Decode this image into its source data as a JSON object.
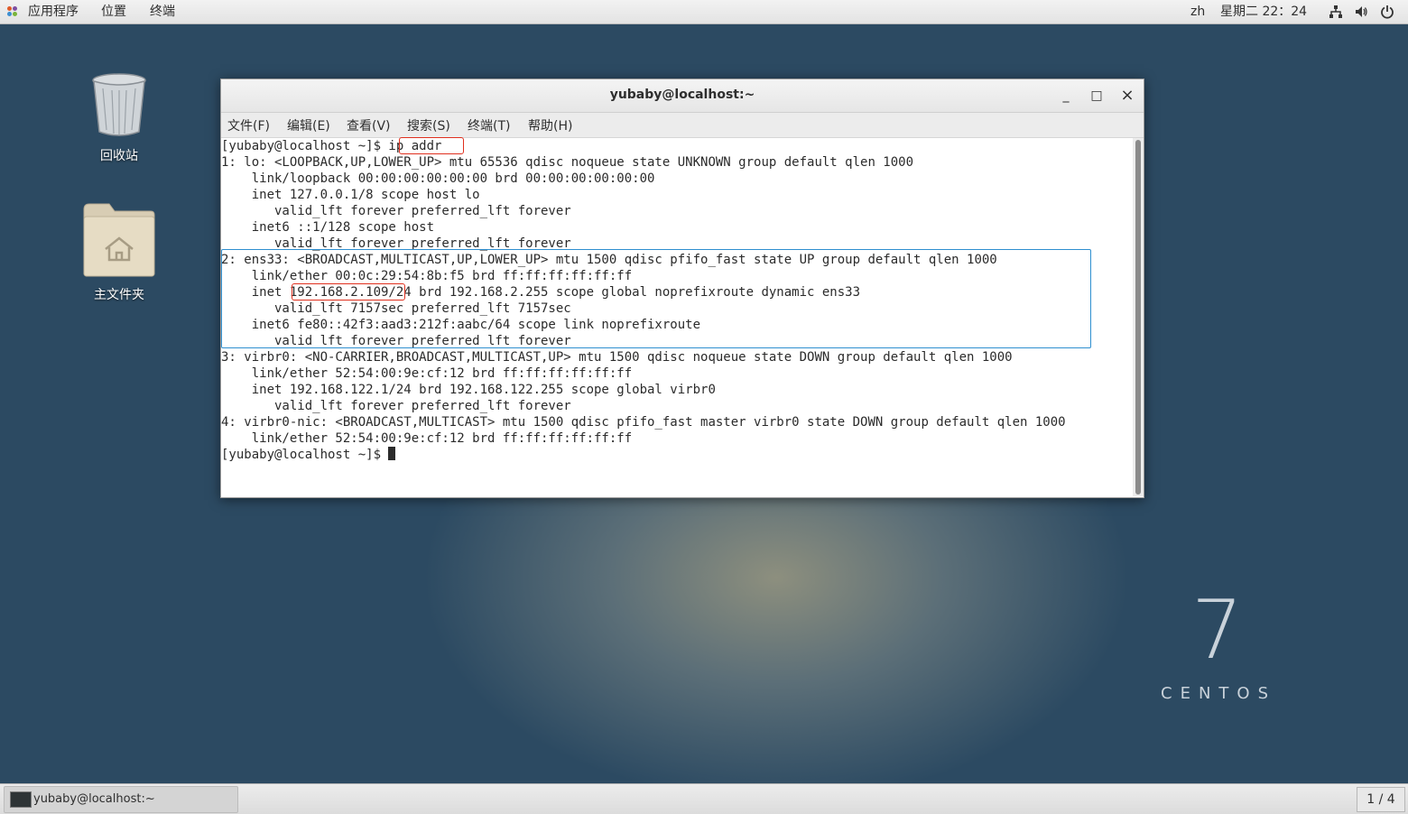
{
  "topbar": {
    "applications": "应用程序",
    "places": "位置",
    "terminal": "终端",
    "lang": "zh",
    "clock": "星期二 22：24"
  },
  "desktop": {
    "trash_label": "回收站",
    "home_label": "主文件夹",
    "brand_number": "7",
    "brand_word": "CENTOS"
  },
  "window": {
    "title": "yubaby@localhost:~",
    "minimize": "_",
    "maximize": "□",
    "close": "×",
    "menu": [
      "文件(F)",
      "编辑(E)",
      "查看(V)",
      "搜索(S)",
      "终端(T)",
      "帮助(H)"
    ],
    "lines": [
      "[yubaby@localhost ~]$ ip addr",
      "1: lo: <LOOPBACK,UP,LOWER_UP> mtu 65536 qdisc noqueue state UNKNOWN group default qlen 1000",
      "    link/loopback 00:00:00:00:00:00 brd 00:00:00:00:00:00",
      "    inet 127.0.0.1/8 scope host lo",
      "       valid_lft forever preferred_lft forever",
      "    inet6 ::1/128 scope host",
      "       valid_lft forever preferred_lft forever",
      "2: ens33: <BROADCAST,MULTICAST,UP,LOWER_UP> mtu 1500 qdisc pfifo_fast state UP group default qlen 1000",
      "    link/ether 00:0c:29:54:8b:f5 brd ff:ff:ff:ff:ff:ff",
      "    inet 192.168.2.109/24 brd 192.168.2.255 scope global noprefixroute dynamic ens33",
      "       valid_lft 7157sec preferred_lft 7157sec",
      "    inet6 fe80::42f3:aad3:212f:aabc/64 scope link noprefixroute",
      "       valid_lft forever preferred_lft forever",
      "3: virbr0: <NO-CARRIER,BROADCAST,MULTICAST,UP> mtu 1500 qdisc noqueue state DOWN group default qlen 1000",
      "    link/ether 52:54:00:9e:cf:12 brd ff:ff:ff:ff:ff:ff",
      "    inet 192.168.122.1/24 brd 192.168.122.255 scope global virbr0",
      "       valid_lft forever preferred_lft forever",
      "4: virbr0-nic: <BROADCAST,MULTICAST> mtu 1500 qdisc pfifo_fast master virbr0 state DOWN group default qlen 1000",
      "    link/ether 52:54:00:9e:cf:12 brd ff:ff:ff:ff:ff:ff"
    ],
    "prompt": "[yubaby@localhost ~]$ "
  },
  "taskbar": {
    "task_label": "yubaby@localhost:~",
    "workspace": "1 / 4"
  },
  "colors": {
    "highlight_red": "#e0301e",
    "highlight_blue": "#2f8fd0"
  }
}
